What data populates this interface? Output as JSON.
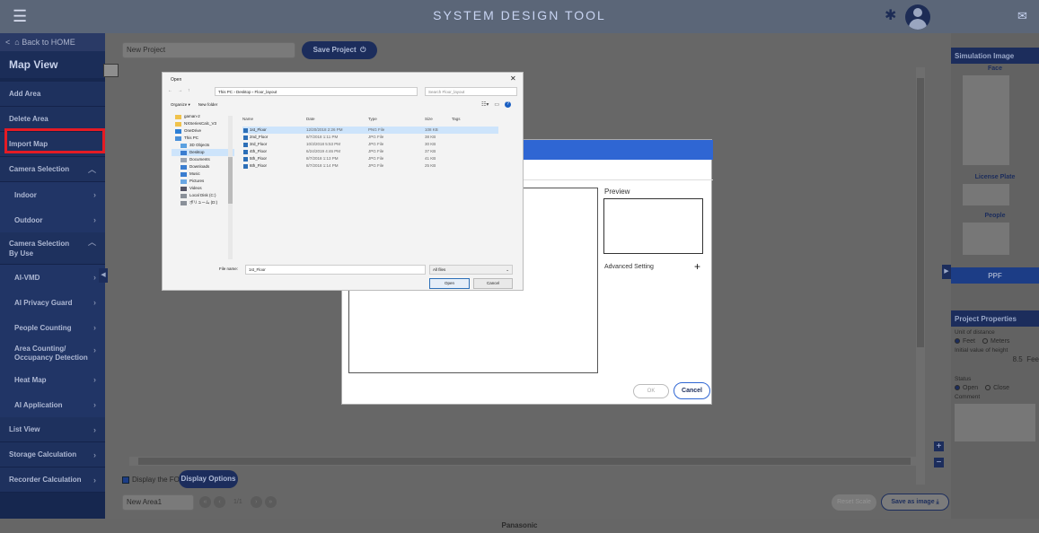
{
  "app": {
    "title": "SYSTEM DESIGN TOOL",
    "footer_brand": "Panasonic"
  },
  "sidebar": {
    "back": "Back to HOME",
    "map_view": "Map View",
    "items": [
      {
        "label": "Add Area"
      },
      {
        "label": "Delete Area"
      },
      {
        "label": "Import Map"
      },
      {
        "label": "Camera Selection"
      },
      {
        "label": "Indoor"
      },
      {
        "label": "Outdoor"
      },
      {
        "label": "Camera Selection By Use"
      },
      {
        "label": "AI-VMD"
      },
      {
        "label": "AI Privacy Guard"
      },
      {
        "label": "People Counting"
      },
      {
        "label": "Area Counting/ Occupancy Detection"
      },
      {
        "label": "Heat Map"
      },
      {
        "label": "AI Application"
      },
      {
        "label": "List View"
      },
      {
        "label": "Storage Calculation"
      },
      {
        "label": "Recorder Calculation"
      }
    ]
  },
  "main": {
    "project_name": "New Project",
    "save_project": "Save Project",
    "display_fov": "Display the FOV",
    "display_options": "Display Options",
    "area_name": "New Area1",
    "page_text": "1/1",
    "reset_scale": "Reset Scale",
    "save_as_image": "Save as image"
  },
  "right_panel": {
    "simulation_image": "Simulation Image",
    "face": "Face",
    "license_plate": "License Plate",
    "people": "People",
    "ppf": "PPF",
    "project_properties": "Project Properties",
    "unit_label": "Unit of distance",
    "unit_feet": "Feet",
    "unit_meters": "Meters",
    "init_height_label": "Initial value of height",
    "init_height_value": "8.5",
    "init_height_unit": "Fee",
    "status_label": "Status",
    "status_open": "Open",
    "status_close": "Close",
    "comment_label": "Comment"
  },
  "import_dialog": {
    "preview_label": "Preview",
    "advanced_setting": "Advanced Setting",
    "ok": "OK",
    "cancel": "Cancel"
  },
  "open_dialog": {
    "title": "Open",
    "breadcrumb": "This PC › Desktop › Floor_layout",
    "search_placeholder": "Search Floor_layout",
    "organize": "Organize ▾",
    "new_folder": "New folder",
    "tree": [
      {
        "label": "gaman-2",
        "color": "#f0c24b"
      },
      {
        "label": "NXSeriesCalc_V3",
        "color": "#f0c24b"
      },
      {
        "label": "OneDrive",
        "color": "#2d7fd6"
      },
      {
        "label": "This PC",
        "color": "#4a90d9"
      },
      {
        "label": "3D Objects",
        "color": "#5aa0e0"
      },
      {
        "label": "Desktop",
        "color": "#3a7dd0"
      },
      {
        "label": "Documents",
        "color": "#9aa4b3"
      },
      {
        "label": "Downloads",
        "color": "#3a7dd0"
      },
      {
        "label": "Music",
        "color": "#3a7dd0"
      },
      {
        "label": "Pictures",
        "color": "#6aa6e3"
      },
      {
        "label": "Videos",
        "color": "#556"
      },
      {
        "label": "Local Disk (C:)",
        "color": "#8a9099"
      },
      {
        "label": "ボリューム (D:)",
        "color": "#8a9099"
      }
    ],
    "columns": [
      "Name",
      "Date",
      "Type",
      "Size",
      "Tags"
    ],
    "files": [
      {
        "name": "1st_Floor",
        "date": "12/20/2018 2:26 PM",
        "type": "PNG File",
        "size": "108 KB"
      },
      {
        "name": "2nd_Floor",
        "date": "8/7/2018 1:11 PM",
        "type": "JPG File",
        "size": "38 KB"
      },
      {
        "name": "3rd_Floor",
        "date": "10/3/2018 5:53 PM",
        "type": "JPG File",
        "size": "30 KB"
      },
      {
        "name": "4th_Floor",
        "date": "6/24/2019 4:46 PM",
        "type": "JPG File",
        "size": "37 KB"
      },
      {
        "name": "5th_Floor",
        "date": "8/7/2018 1:13 PM",
        "type": "JPG File",
        "size": "41 KB"
      },
      {
        "name": "6th_Floor",
        "date": "8/7/2018 1:14 PM",
        "type": "JPG File",
        "size": "25 KB"
      }
    ],
    "file_name_label": "File name:",
    "file_name_value": "1st_Floor",
    "file_type": "All files",
    "open_button": "Open",
    "cancel_button": "Cancel"
  },
  "colors": {
    "navy": "#16274f",
    "accent_blue": "#2f66d3",
    "highlight_red": "#e51b24"
  }
}
